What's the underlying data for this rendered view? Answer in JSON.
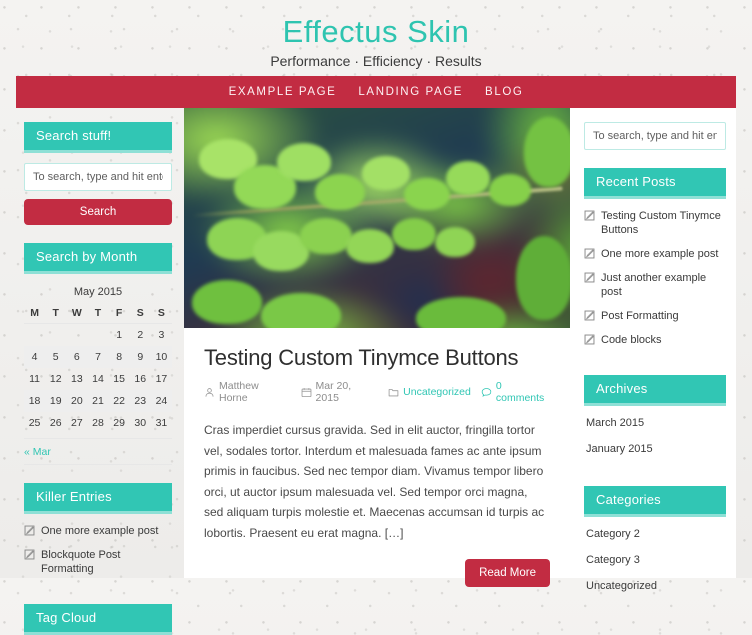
{
  "site": {
    "title": "Effectus Skin",
    "tagline": "Performance · Efficiency · Results",
    "accent_teal": "#31c6b4",
    "accent_teal_light": "#8ee0d6",
    "accent_crimson": "#c22c42",
    "page_background": "#f2f1ef"
  },
  "nav": {
    "items": [
      {
        "label": "EXAMPLE PAGE"
      },
      {
        "label": "LANDING PAGE"
      },
      {
        "label": "BLOG"
      }
    ]
  },
  "left_sidebar": {
    "search_widget": {
      "title": "Search stuff!",
      "input_placeholder": "To search, type and hit enter",
      "input_value": "",
      "button_label": "Search"
    },
    "calendar_widget": {
      "title": "Search by Month",
      "caption": "May 2015",
      "weekdays": [
        "M",
        "T",
        "W",
        "T",
        "F",
        "S",
        "S"
      ],
      "weeks": [
        [
          "",
          "",
          "",
          "",
          "1",
          "2",
          "3"
        ],
        [
          "4",
          "5",
          "6",
          "7",
          "8",
          "9",
          "10"
        ],
        [
          "11",
          "12",
          "13",
          "14",
          "15",
          "16",
          "17"
        ],
        [
          "18",
          "19",
          "20",
          "21",
          "22",
          "23",
          "24"
        ],
        [
          "25",
          "26",
          "27",
          "28",
          "29",
          "30",
          "31"
        ]
      ],
      "prev_link": "« Mar"
    },
    "killer_entries_widget": {
      "title": "Killer Entries",
      "icon": "post-edit-icon",
      "items": [
        {
          "label": "One more example post"
        },
        {
          "label": "Blockquote Post Formatting"
        }
      ]
    },
    "tag_cloud_widget": {
      "title": "Tag Cloud"
    }
  },
  "right_sidebar": {
    "search_widget": {
      "input_placeholder": "To search, type and hit enter",
      "input_value": ""
    },
    "recent_posts_widget": {
      "title": "Recent Posts",
      "icon": "post-edit-icon",
      "items": [
        {
          "label": "Testing Custom Tinymce Buttons"
        },
        {
          "label": "One more example post"
        },
        {
          "label": "Just another example post"
        },
        {
          "label": "Post Formatting"
        },
        {
          "label": "Code blocks"
        }
      ]
    },
    "archives_widget": {
      "title": "Archives",
      "items": [
        {
          "label": "March 2015"
        },
        {
          "label": "January 2015"
        }
      ]
    },
    "categories_widget": {
      "title": "Categories",
      "items": [
        {
          "label": "Category 2"
        },
        {
          "label": "Category 3"
        },
        {
          "label": "Uncategorized"
        }
      ]
    }
  },
  "post": {
    "featured_image_alt": "Blurred close-up photograph of a green fern frond",
    "title": "Testing Custom Tinymce Buttons",
    "meta": {
      "author": "Matthew Horne",
      "author_icon": "user-icon",
      "date": "Mar 20, 2015",
      "date_icon": "calendar-icon",
      "category": "Uncategorized",
      "category_icon": "folder-icon",
      "comments": "0 comments",
      "comments_icon": "comment-icon"
    },
    "excerpt": "Cras imperdiet cursus gravida. Sed in elit auctor, fringilla tortor vel, sodales tortor. Interdum et malesuada fames ac ante ipsum primis in faucibus. Sed nec tempor diam. Vivamus tempor libero orci, ut auctor ipsum malesuada vel. Sed tempor orci magna, sed aliquam turpis molestie et. Maecenas accumsan id turpis ac lobortis. Praesent eu erat magna. […]",
    "read_more_label": "Read More"
  }
}
